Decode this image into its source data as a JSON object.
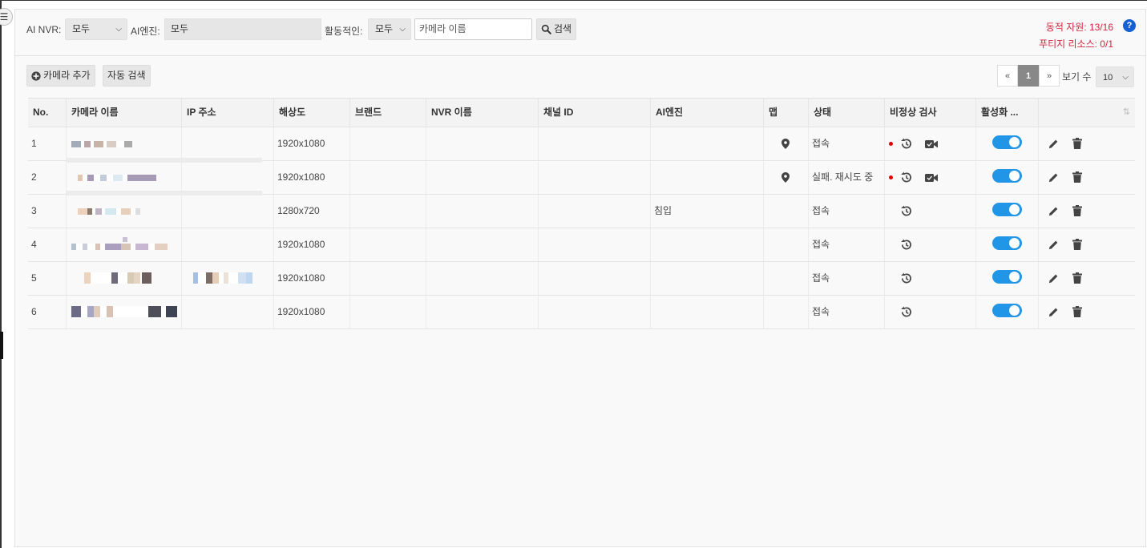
{
  "filters": {
    "nvr_label": "AI NVR:",
    "nvr_value": "모두",
    "engine_label": "AI엔진:",
    "engine_value": "모두",
    "active_label": "활동적인:",
    "active_value": "모두",
    "camera_name_placeholder": "카메라 이름",
    "search_label": "검색"
  },
  "resources": {
    "dynamic": "동적 자원:  13/16",
    "edge": "푸티지 리소스:  0/1"
  },
  "toolbar": {
    "add_camera_label": "카메라 추가",
    "auto_search_label": "자동 검색"
  },
  "pagination": {
    "prev": "«",
    "current": "1",
    "next": "»",
    "page_size_label": "보기 수",
    "page_size_value": "10"
  },
  "table": {
    "columns": [
      "No.",
      "카메라 이름",
      "IP 주소",
      "해상도",
      "브랜드",
      "NVR 이름",
      "채널 ID",
      "AI엔진",
      "맵",
      "상태",
      "비정상 검사",
      "활성화 ...",
      ""
    ],
    "rows": [
      {
        "no": "1",
        "resolution": "1920x1080",
        "ai_engine": "",
        "status": "접속",
        "has_map": true,
        "has_alert": true,
        "has_video": true,
        "enabled": true
      },
      {
        "no": "2",
        "resolution": "1920x1080",
        "ai_engine": "",
        "status": "실패. 재시도 중",
        "has_map": true,
        "has_alert": true,
        "has_video": true,
        "enabled": true
      },
      {
        "no": "3",
        "resolution": "1280x720",
        "ai_engine": "침입",
        "status": "접속",
        "has_map": false,
        "has_alert": false,
        "has_video": false,
        "enabled": true
      },
      {
        "no": "4",
        "resolution": "1920x1080",
        "ai_engine": "",
        "status": "접속",
        "has_map": false,
        "has_alert": false,
        "has_video": false,
        "enabled": true
      },
      {
        "no": "5",
        "resolution": "1920x1080",
        "ai_engine": "",
        "status": "접속",
        "has_map": false,
        "has_alert": false,
        "has_video": false,
        "enabled": true
      },
      {
        "no": "6",
        "resolution": "1920x1080",
        "ai_engine": "",
        "status": "접속",
        "has_map": false,
        "has_alert": false,
        "has_video": false,
        "enabled": true
      }
    ]
  },
  "colors": {
    "accent": "#2296e6",
    "resource_text": "#d0243c",
    "help": "#1560d4",
    "alert_dot": "#e00000"
  },
  "icons": {
    "menu": "menu-icon",
    "search": "search-icon",
    "add": "plus-circle-icon",
    "map": "map-pin-icon",
    "history": "history-icon",
    "video": "video-camera-icon",
    "edit": "pencil-icon",
    "delete": "trash-icon",
    "help": "help-icon",
    "sort": "sort-icon"
  }
}
